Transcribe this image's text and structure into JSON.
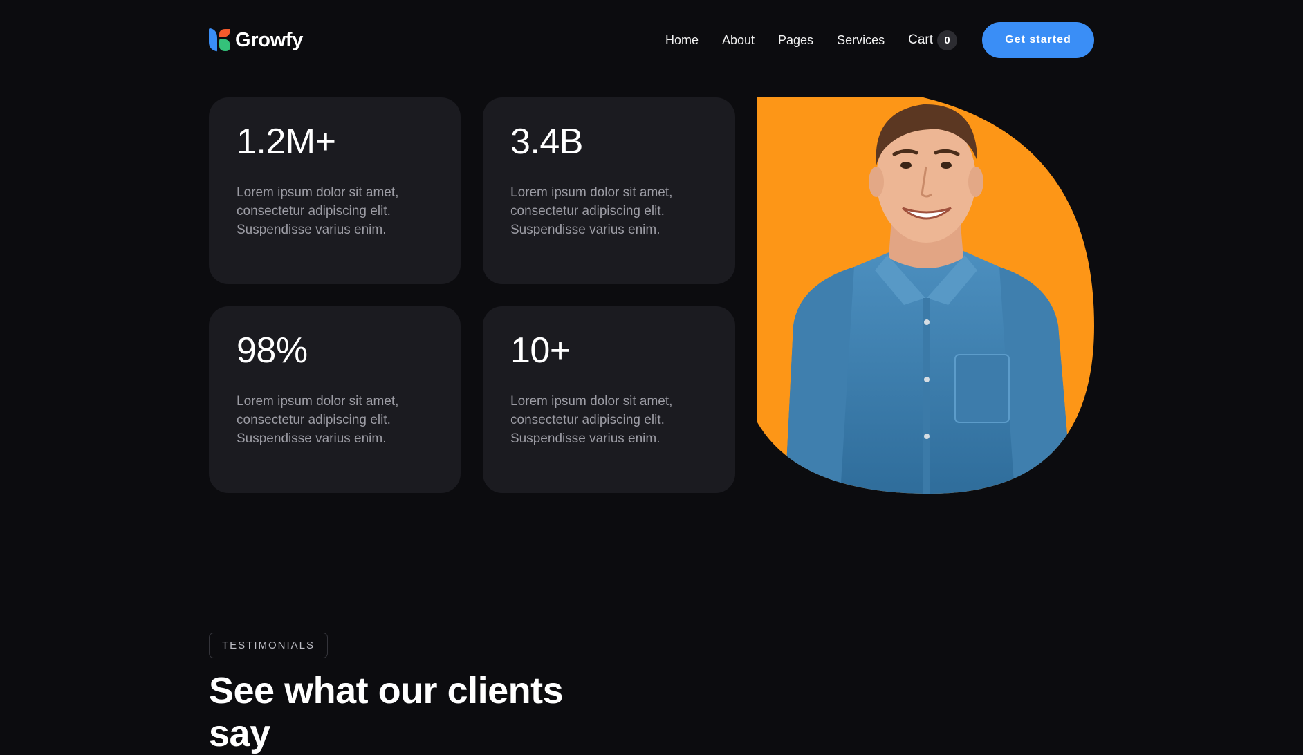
{
  "brand": {
    "name": "Growfy",
    "logo_icon": "growfy-logo-icon"
  },
  "nav": {
    "items": [
      "Home",
      "About",
      "Pages",
      "Services"
    ],
    "cart": {
      "label": "Cart",
      "count": "0"
    },
    "cta_label": "Get started"
  },
  "stats": [
    {
      "value": "1.2M+",
      "description": "Lorem ipsum dolor sit amet, consectetur adipiscing elit. Suspendisse varius enim."
    },
    {
      "value": "3.4B",
      "description": "Lorem ipsum dolor sit amet, consectetur adipiscing elit. Suspendisse varius enim."
    },
    {
      "value": "98%",
      "description": "Lorem ipsum dolor sit amet, consectetur adipiscing elit. Suspendisse varius enim."
    },
    {
      "value": "10+",
      "description": "Lorem ipsum dolor sit amet, consectetur adipiscing elit. Suspendisse varius enim."
    }
  ],
  "hero_image": {
    "subject": "smiling-man-denim-shirt",
    "background_color": "#fd9617"
  },
  "testimonials": {
    "tag": "TESTIMONIALS",
    "title": "See what our clients say"
  },
  "colors": {
    "background": "#0c0c0f",
    "card": "#1b1b20",
    "accent_blue": "#3a8ef6",
    "accent_orange": "#fd9617",
    "logo_blue": "#3a8ef6",
    "logo_orange": "#f25a2c",
    "logo_green": "#34c27a"
  }
}
